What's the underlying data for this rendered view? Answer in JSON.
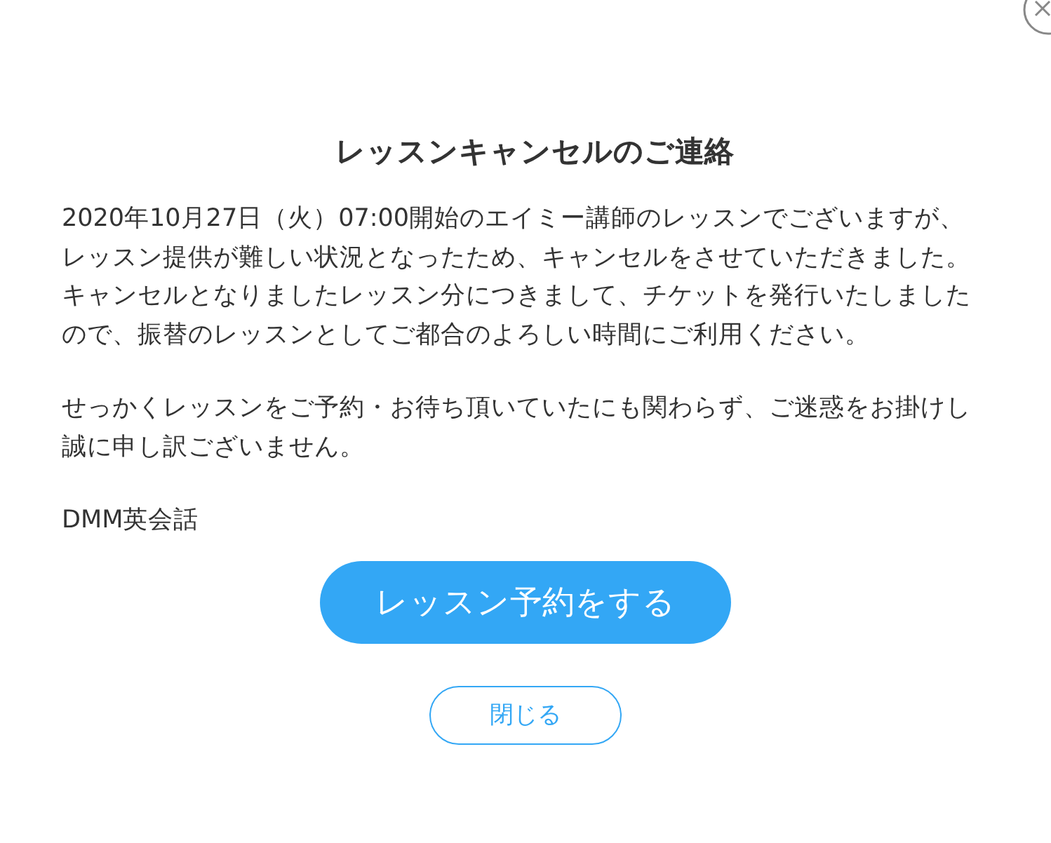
{
  "dialog": {
    "title": "レッスンキャンセルのご連絡",
    "paragraphs": [
      {
        "lines": [
          "2020年10月27日（火）07:00開始のエイミー講師のレッスンでございますが、",
          "レッスン提供が難しい状況となったため、キャンセルをさせていただきました。",
          "キャンセルとなりましたレッスン分につきまして、チケットを発行いたしました",
          "ので、振替のレッスンとしてご都合のよろしい時間にご利用ください。"
        ]
      },
      {
        "lines": [
          "せっかくレッスンをご予約・お待ち頂いていたにも関わらず、ご迷惑をお掛けし",
          "誠に申し訳ございません。"
        ]
      }
    ],
    "signature": "DMM英会話",
    "buttons": [
      {
        "label": "レッスン予約をする",
        "kind": "primary"
      },
      {
        "label": "閉じる",
        "kind": "secondary"
      }
    ]
  }
}
